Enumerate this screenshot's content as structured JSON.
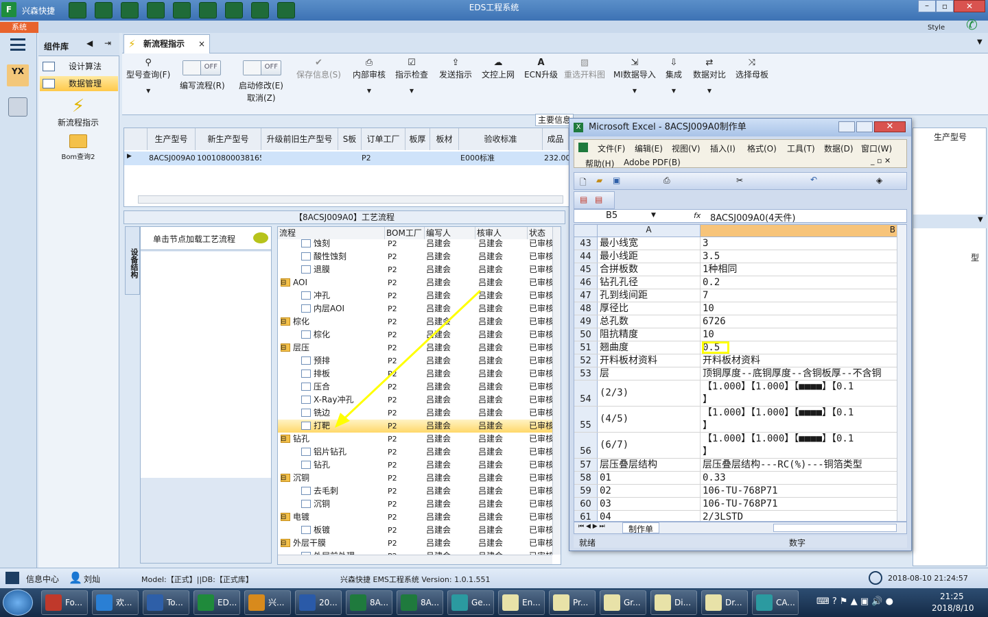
{
  "app": {
    "short_title": "兴森快捷",
    "title": "EDS工程系统",
    "style_label": "Style",
    "system_tab": "系统"
  },
  "component_panel": {
    "title": "组件库",
    "items": [
      {
        "label": "设计算法"
      },
      {
        "label": "数据管理"
      }
    ],
    "tools": [
      {
        "label": "新流程指示"
      },
      {
        "label": "Bom查询2"
      }
    ]
  },
  "tab": {
    "label": "新流程指示"
  },
  "ribbon": {
    "buttons": [
      {
        "label": "型号查询(F)",
        "icon": "search-icon",
        "disabled": false
      },
      {
        "label": "保存信息(S)",
        "icon": "check-icon",
        "disabled": true
      },
      {
        "label": "内部审核",
        "icon": "printer-icon",
        "disabled": false
      },
      {
        "label": "指示检查",
        "icon": "checkbox-icon",
        "disabled": false
      },
      {
        "label": "发送指示",
        "icon": "upload-icon",
        "disabled": false
      },
      {
        "label": "文控上网",
        "icon": "cloud-icon",
        "disabled": false
      },
      {
        "label": "ECN升级",
        "icon": "letter-icon",
        "disabled": false
      },
      {
        "label": "重选开料图",
        "icon": "image-icon",
        "disabled": true
      },
      {
        "label": "MI数据导入",
        "icon": "import-icon",
        "disabled": false
      },
      {
        "label": "集成",
        "icon": "download-icon",
        "disabled": false
      },
      {
        "label": "数据对比",
        "icon": "compare-icon",
        "disabled": false
      },
      {
        "label": "选择母板",
        "icon": "shuffle-icon",
        "disabled": false
      }
    ],
    "toggles": [
      {
        "state": "OFF",
        "label": "编写流程(R)"
      },
      {
        "state": "OFF",
        "label": "启动修改(E)",
        "label2": "取消(Z)"
      }
    ]
  },
  "main_info_label": "主要信息",
  "grid": {
    "headers": [
      "生产型号",
      "新生产型号",
      "升级前旧生产型号",
      "S板",
      "订单工厂",
      "板厚",
      "板材",
      "验收标准",
      "成品"
    ],
    "row": [
      "8ACSJ009A0",
      "10010800038165",
      "",
      "",
      "P2",
      "",
      "",
      "E000标准",
      "232.00"
    ]
  },
  "process_panel": {
    "title": "【8ACSJ009A0】工艺流程",
    "vertical_tab": "设备结构",
    "node_hint": "单击节点加载工艺流程"
  },
  "tree": {
    "headers": [
      "流程",
      "BOM工厂",
      "编写人",
      "核审人",
      "状态"
    ],
    "rows": [
      {
        "name": "蚀刻",
        "level": 1,
        "folder": false,
        "factory": "P2",
        "writer": "吕建会",
        "checker": "吕建会",
        "status": "已审核",
        "selected": false
      },
      {
        "name": "酸性蚀刻",
        "level": 1,
        "folder": false,
        "factory": "P2",
        "writer": "吕建会",
        "checker": "吕建会",
        "status": "已审核",
        "selected": false
      },
      {
        "name": "退膜",
        "level": 1,
        "folder": false,
        "factory": "P2",
        "writer": "吕建会",
        "checker": "吕建会",
        "status": "已审核",
        "selected": false
      },
      {
        "name": "AOI",
        "level": 0,
        "folder": true,
        "factory": "P2",
        "writer": "吕建会",
        "checker": "吕建会",
        "status": "已审核",
        "selected": false
      },
      {
        "name": "冲孔",
        "level": 1,
        "folder": false,
        "factory": "P2",
        "writer": "吕建会",
        "checker": "吕建会",
        "status": "已审核",
        "selected": false
      },
      {
        "name": "内层AOI",
        "level": 1,
        "folder": false,
        "factory": "P2",
        "writer": "吕建会",
        "checker": "吕建会",
        "status": "已审核",
        "selected": false
      },
      {
        "name": "棕化",
        "level": 0,
        "folder": true,
        "factory": "P2",
        "writer": "吕建会",
        "checker": "吕建会",
        "status": "已审核",
        "selected": false
      },
      {
        "name": "棕化",
        "level": 1,
        "folder": false,
        "factory": "P2",
        "writer": "吕建会",
        "checker": "吕建会",
        "status": "已审核",
        "selected": false
      },
      {
        "name": "层压",
        "level": 0,
        "folder": true,
        "factory": "P2",
        "writer": "吕建会",
        "checker": "吕建会",
        "status": "已审核",
        "selected": false
      },
      {
        "name": "预排",
        "level": 1,
        "folder": false,
        "factory": "P2",
        "writer": "吕建会",
        "checker": "吕建会",
        "status": "已审核",
        "selected": false
      },
      {
        "name": "排板",
        "level": 1,
        "folder": false,
        "factory": "P2",
        "writer": "吕建会",
        "checker": "吕建会",
        "status": "已审核",
        "selected": false
      },
      {
        "name": "压合",
        "level": 1,
        "folder": false,
        "factory": "P2",
        "writer": "吕建会",
        "checker": "吕建会",
        "status": "已审核",
        "selected": false
      },
      {
        "name": "X-Ray冲孔",
        "level": 1,
        "folder": false,
        "factory": "P2",
        "writer": "吕建会",
        "checker": "吕建会",
        "status": "已审核",
        "selected": false
      },
      {
        "name": "铣边",
        "level": 1,
        "folder": false,
        "factory": "P2",
        "writer": "吕建会",
        "checker": "吕建会",
        "status": "已审核",
        "selected": false
      },
      {
        "name": "打靶",
        "level": 1,
        "folder": false,
        "factory": "P2",
        "writer": "吕建会",
        "checker": "吕建会",
        "status": "已审核",
        "selected": true
      },
      {
        "name": "钻孔",
        "level": 0,
        "folder": true,
        "factory": "P2",
        "writer": "吕建会",
        "checker": "吕建会",
        "status": "已审核",
        "selected": false
      },
      {
        "name": "铝片钻孔",
        "level": 1,
        "folder": false,
        "factory": "P2",
        "writer": "吕建会",
        "checker": "吕建会",
        "status": "已审核",
        "selected": false
      },
      {
        "name": "钻孔",
        "level": 1,
        "folder": false,
        "factory": "P2",
        "writer": "吕建会",
        "checker": "吕建会",
        "status": "已审核",
        "selected": false
      },
      {
        "name": "沉铜",
        "level": 0,
        "folder": true,
        "factory": "P2",
        "writer": "吕建会",
        "checker": "吕建会",
        "status": "已审核",
        "selected": false
      },
      {
        "name": "去毛刺",
        "level": 1,
        "folder": false,
        "factory": "P2",
        "writer": "吕建会",
        "checker": "吕建会",
        "status": "已审核",
        "selected": false
      },
      {
        "name": "沉铜",
        "level": 1,
        "folder": false,
        "factory": "P2",
        "writer": "吕建会",
        "checker": "吕建会",
        "status": "已审核",
        "selected": false
      },
      {
        "name": "电镀",
        "level": 0,
        "folder": true,
        "factory": "P2",
        "writer": "吕建会",
        "checker": "吕建会",
        "status": "已审核",
        "selected": false
      },
      {
        "name": "板镀",
        "level": 1,
        "folder": false,
        "factory": "P2",
        "writer": "吕建会",
        "checker": "吕建会",
        "status": "已审核",
        "selected": false
      },
      {
        "name": "外层干膜",
        "level": 0,
        "folder": true,
        "factory": "P2",
        "writer": "吕建会",
        "checker": "吕建会",
        "status": "已审核",
        "selected": false
      },
      {
        "name": "外层前处理",
        "level": 1,
        "folder": false,
        "factory": "P2",
        "writer": "吕建会",
        "checker": "吕建会",
        "status": "已审核",
        "selected": false
      }
    ]
  },
  "excel": {
    "title": "Microsoft Excel - 8ACSJ009A0制作单",
    "menu": [
      "文件(F)",
      "编辑(E)",
      "视图(V)",
      "插入(I)",
      "格式(O)",
      "工具(T)",
      "数据(D)",
      "窗口(W)",
      "帮助(H)",
      "Adobe PDF(B)"
    ],
    "namebox": "B5",
    "fx": "fx",
    "formula": "8ACSJ009A0(4天件)",
    "col_a": "A",
    "col_b": "B",
    "rows": [
      {
        "n": "43",
        "a": "最小线宽",
        "b": "3"
      },
      {
        "n": "44",
        "a": "最小线距",
        "b": "3.5"
      },
      {
        "n": "45",
        "a": "合拼板数",
        "b": "1种相同"
      },
      {
        "n": "46",
        "a": "钻孔孔径",
        "b": "0.2"
      },
      {
        "n": "47",
        "a": "孔到线间距",
        "b": "7"
      },
      {
        "n": "48",
        "a": "厚径比",
        "b": "10"
      },
      {
        "n": "49",
        "a": "总孔数",
        "b": "6726"
      },
      {
        "n": "50",
        "a": "阻抗精度",
        "b": "10"
      },
      {
        "n": "51",
        "a": "翘曲度",
        "b": "0.5"
      },
      {
        "n": "52",
        "a": "开料板材资料",
        "b": "开料板材资料"
      },
      {
        "n": "53",
        "a": "层",
        "b": "顶铜厚度--底铜厚度--含铜板厚--不含铜"
      },
      {
        "n": "54",
        "a": "(2/3)",
        "b": "【1.000】【1.000】【■■■■】【0.1",
        "b2": "】"
      },
      {
        "n": "55",
        "a": "(4/5)",
        "b": "【1.000】【1.000】【■■■■】【0.1",
        "b2": "】"
      },
      {
        "n": "56",
        "a": "(6/7)",
        "b": "【1.000】【1.000】【■■■■】【0.1",
        "b2": "】"
      },
      {
        "n": "57",
        "a": "层压叠层结构",
        "b": "层压叠层结构---RC(%)---铜箔类型"
      },
      {
        "n": "58",
        "a": "01",
        "b": "0.33"
      },
      {
        "n": "59",
        "a": "02",
        "b": "106-TU-768P71"
      },
      {
        "n": "60",
        "a": "03",
        "b": "106-TU-768P71"
      },
      {
        "n": "61",
        "a": "04",
        "b": "2/3LSTD"
      }
    ],
    "sheet_tab": "制作单",
    "status_left": "就绪",
    "status_mid": "数字"
  },
  "right_panel": {
    "header": "生产型号",
    "col_label": "型"
  },
  "statusbar": {
    "info_center": "信息中心",
    "user": "刘灿",
    "model": "Model:【正式】||DB:【正式库】",
    "version": "兴森快捷 EMS工程系统  Version: 1.0.1.551",
    "datetime": "2018-08-10 21:24:57"
  },
  "taskbar": {
    "items": [
      {
        "label": "Fo...",
        "color": "#c0392b"
      },
      {
        "label": "欢...",
        "color": "#2a7fd4"
      },
      {
        "label": "To...",
        "color": "#2e5fa8"
      },
      {
        "label": "ED...",
        "color": "#1f8a3b"
      },
      {
        "label": "兴...",
        "color": "#d88a1c"
      },
      {
        "label": "20...",
        "color": "#2a5aa8"
      },
      {
        "label": "8A...",
        "color": "#1f7a3d"
      },
      {
        "label": "8A...",
        "color": "#1f7a3d"
      },
      {
        "label": "Ge...",
        "color": "#2b9aa0"
      },
      {
        "label": "En...",
        "color": "#e8e2a8"
      },
      {
        "label": "Pr...",
        "color": "#e8e2a8"
      },
      {
        "label": "Gr...",
        "color": "#e8e2a8"
      },
      {
        "label": "Di...",
        "color": "#e8e2a8"
      },
      {
        "label": "Dr...",
        "color": "#e8e2a8"
      },
      {
        "label": "CA...",
        "color": "#2b9aa0"
      }
    ],
    "time": "21:25",
    "date": "2018/8/10"
  },
  "colors": {
    "accent_orange": "#e8632c",
    "highlight_yellow": "#ffff00",
    "selection": "#ffd86a"
  }
}
